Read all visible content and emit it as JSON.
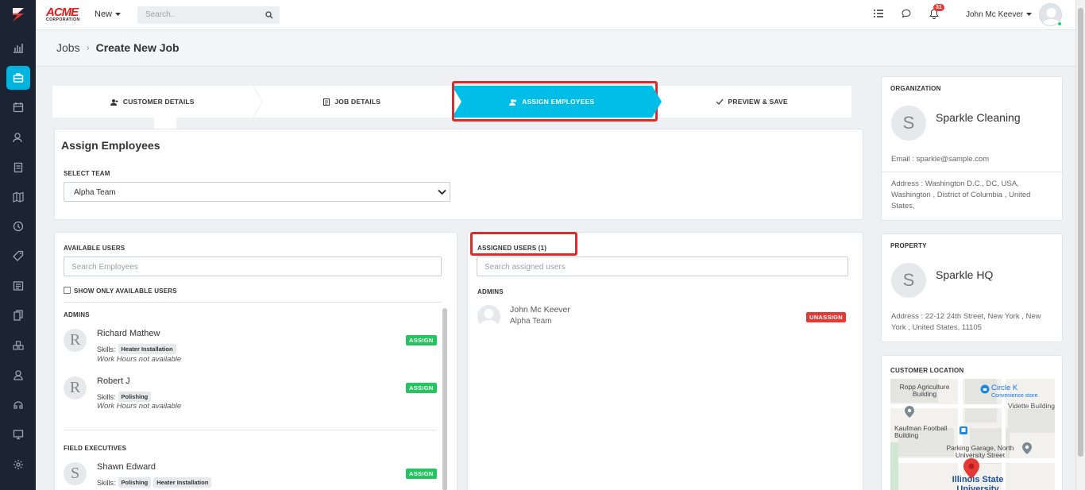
{
  "topbar": {
    "logo_text": "ACME",
    "logo_sub": "CORPORATION",
    "new_label": "New",
    "search_placeholder": "Search..",
    "notification_count": "31",
    "user_name": "John Mc Keever"
  },
  "breadcrumb": {
    "parent": "Jobs",
    "current": "Create New Job"
  },
  "steps": [
    {
      "label": "CUSTOMER DETAILS",
      "icon": "user-icon"
    },
    {
      "label": "JOB DETAILS",
      "icon": "clipboard-icon"
    },
    {
      "label": "ASSIGN EMPLOYEES",
      "icon": "users-icon",
      "active": true
    },
    {
      "label": "PREVIEW & SAVE",
      "icon": "check-icon"
    }
  ],
  "assign": {
    "title": "Assign Employees",
    "team_label": "SELECT TEAM",
    "team_value": "Alpha Team"
  },
  "available": {
    "title": "AVAILABLE USERS",
    "search_placeholder": "Search Employees",
    "only_available_label": "SHOW ONLY AVAILABLE USERS",
    "admins_heading": "ADMINS",
    "field_heading": "FIELD EXECUTIVES",
    "skills_label": "Skills:",
    "assign_label": "ASSIGN",
    "users": [
      {
        "initial": "R",
        "name": "Richard Mathew",
        "skills": [
          "Heater Installation"
        ],
        "hours": "Work Hours not available"
      },
      {
        "initial": "R",
        "name": "Robert J",
        "skills": [
          "Polishing"
        ],
        "hours": "Work Hours not available"
      },
      {
        "initial": "S",
        "name": "Shawn Edward",
        "skills": [
          "Polishing",
          "Heater Installation"
        ]
      }
    ]
  },
  "assigned": {
    "title": "ASSIGNED USERS (1)",
    "search_placeholder": "Search assigned users",
    "admins_heading": "ADMINS",
    "user_name": "John Mc Keever",
    "user_team": "Alpha Team",
    "unassign_label": "UNASSIGN"
  },
  "organization": {
    "title": "ORGANIZATION",
    "initial": "S",
    "name": "Sparkle Cleaning",
    "email": "Email : sparkle@sample.com",
    "address": "Address : Washington D.C., DC, USA, Washington , District of Columbia , United States,"
  },
  "property": {
    "title": "PROPERTY",
    "initial": "S",
    "name": "Sparkle HQ",
    "address": "Address : 22-12 24th Street, New York , New York , United States, 11105"
  },
  "location": {
    "title": "CUSTOMER LOCATION",
    "labels": {
      "ropp": "Ropp Agriculture Building",
      "circle_k": "Circle K",
      "circle_k_sub": "Convenience store",
      "vidette": "Vidette Building",
      "kaufman": "Kaufman Football Building",
      "parking": "Parking Garage, North University Street",
      "illinois": "Illinois State University"
    }
  },
  "colors": {
    "accent": "#00bde8",
    "sidebar": "#1c2433",
    "assign": "#22c55e",
    "unassign": "#e53935",
    "highlight": "#d32f2f"
  }
}
